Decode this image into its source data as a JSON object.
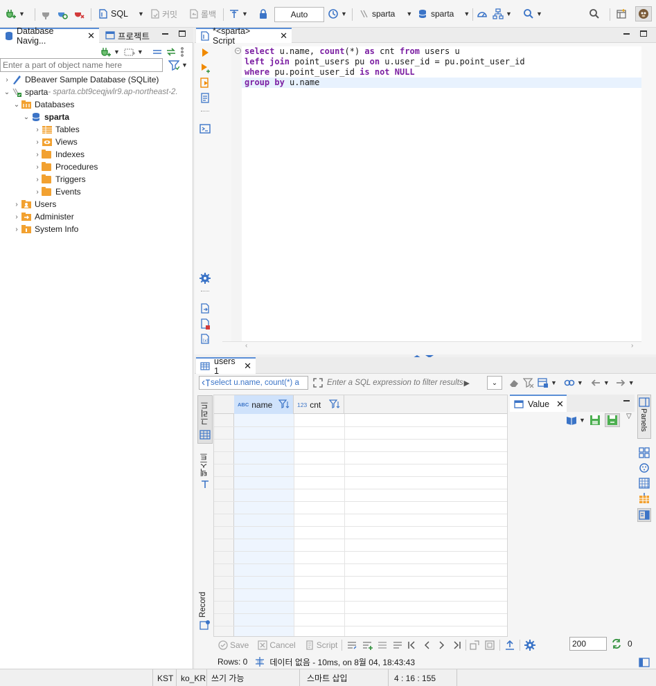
{
  "toolbar": {
    "sql_label": "SQL",
    "commit_label": "커밋",
    "rollback_label": "롤백",
    "transaction_mode": "Auto",
    "datasource_label": "sparta",
    "schema_label": "sparta"
  },
  "navigator": {
    "tab_db_navigator": "Database Navig...",
    "tab_project": "프로젝트",
    "filter_placeholder": "Enter a part of object name here",
    "tree": {
      "sample_db": "DBeaver Sample Database (SQLite)",
      "connection_name": "sparta",
      "connection_host": " - sparta.cbt9ceqjwlr9.ap-northeast-2.",
      "databases": "Databases",
      "schema": "sparta",
      "tables": "Tables",
      "views": "Views",
      "indexes": "Indexes",
      "procedures": "Procedures",
      "triggers": "Triggers",
      "events": "Events",
      "users": "Users",
      "administer": "Administer",
      "system_info": "System Info"
    }
  },
  "editor": {
    "tab_title": "*<sparta> Script",
    "lines": [
      {
        "kw1": "select",
        "t1": " u.name, ",
        "kw2": "count",
        "t2": "(*) ",
        "kw3": "as",
        "t3": " cnt ",
        "kw4": "from",
        "t4": " users u"
      },
      {
        "kw1": "left join",
        "t1": " point_users pu ",
        "kw2": "on",
        "t2": " u.user_id = pu.point_user_id"
      },
      {
        "kw1": "where",
        "t1": " pu.point_user_id ",
        "kw2": "is not NULL"
      },
      {
        "kw1": "group by",
        "t1": " u.name"
      }
    ]
  },
  "results": {
    "tab_title": "users 1",
    "query_text": "select u.name, count(*) a",
    "filter_placeholder": "Enter a SQL expression to filter results",
    "columns": [
      {
        "type_badge": "ABC",
        "name": "name"
      },
      {
        "type_badge": "123",
        "name": "cnt"
      }
    ],
    "side_grid_label": "그리드",
    "side_text_label": "텍스트",
    "side_record_label": "Record",
    "value_panel_title": "Value",
    "panels_label": "Panels",
    "bottom": {
      "save": "Save",
      "cancel": "Cancel",
      "script": "Script",
      "fetch_size": "200",
      "refresh_count": "0"
    },
    "rows_label": "Rows: 0",
    "status_message": "데이터 없음 - 10ms, on 8월 04, 18:43:43"
  },
  "statusbar": {
    "timezone": "KST",
    "locale": "ko_KR",
    "write_mode": "쓰기 가능",
    "insert_mode": "스마트 삽입",
    "cursor_pos": "4 : 16 : 155"
  },
  "colors": {
    "accent_blue": "#3b74c7",
    "keyword": "#7b1fa2",
    "folder": "#f2a130",
    "connect_green": "#2f8f3a",
    "disconnect_red": "#d23a3a"
  }
}
